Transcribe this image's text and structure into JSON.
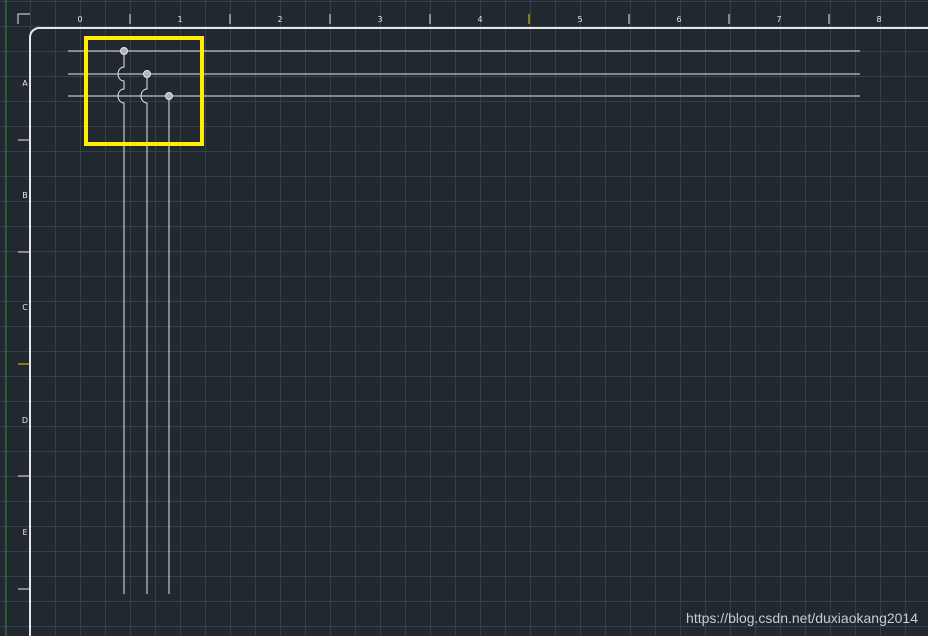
{
  "ruler": {
    "columns": [
      "0",
      "1",
      "2",
      "3",
      "4",
      "5",
      "6",
      "7",
      "8"
    ],
    "rows": [
      "A",
      "B",
      "C",
      "D",
      "E"
    ]
  },
  "colors": {
    "background": "#212830",
    "grid": "#465260",
    "line": "#e6e6e6",
    "cursor_marker": "#e6d200",
    "highlight_box": "#ffee00",
    "left_axis": "#2e7d32"
  },
  "watermark": "https://blog.csdn.net/duxiaokang2014"
}
